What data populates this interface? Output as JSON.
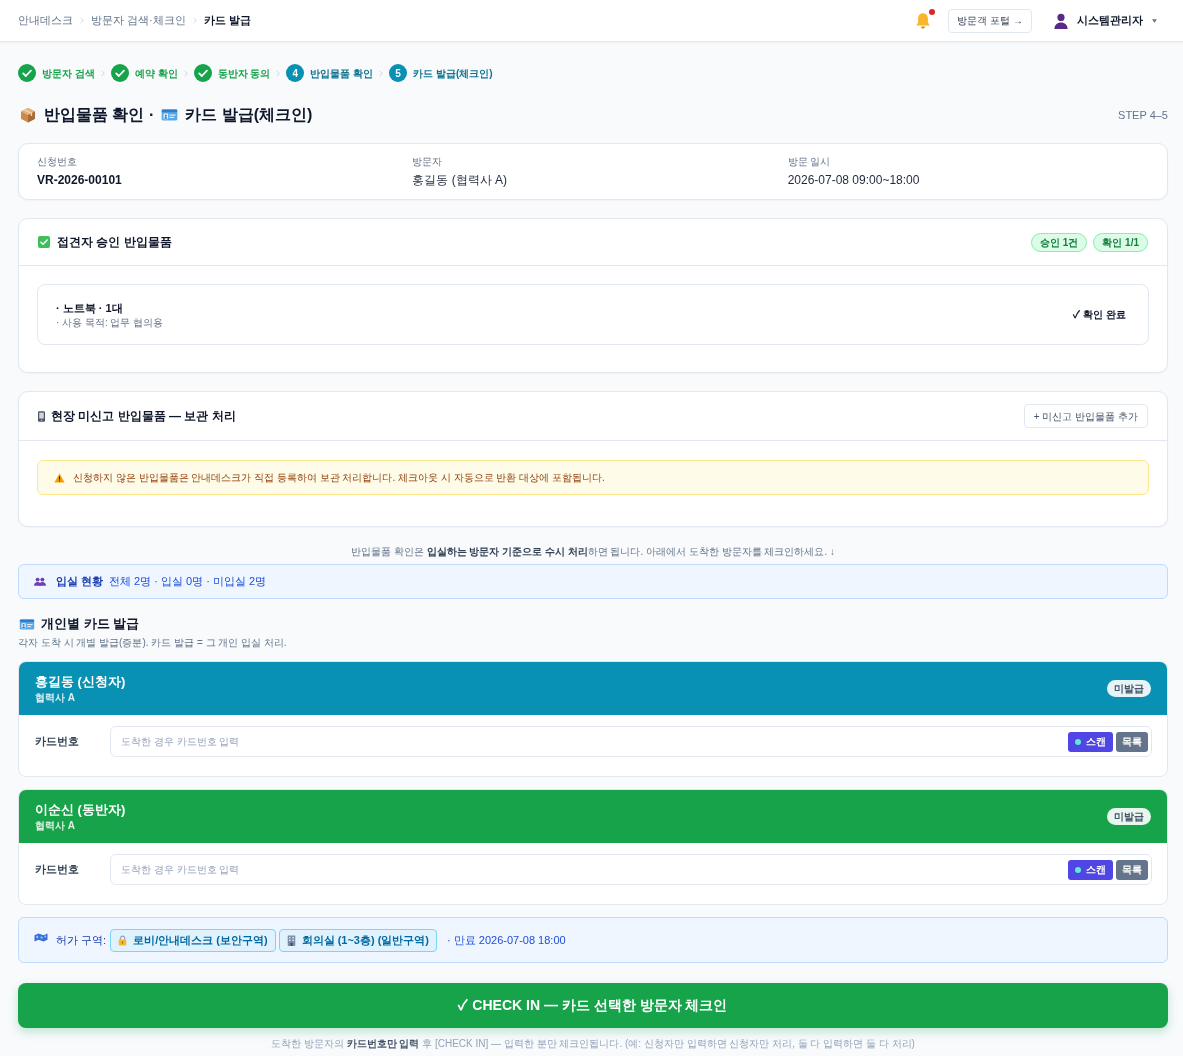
{
  "breadcrumb": [
    {
      "label": "안내데스크",
      "current": false
    },
    {
      "label": "방문자 검색·체크인",
      "current": false
    },
    {
      "label": "카드 발급",
      "current": true
    }
  ],
  "header": {
    "notifications_unread": true,
    "portal_button": "방문객 포털 →",
    "user": "시스템관리자"
  },
  "steps": [
    {
      "label": "방문자 검색",
      "done": true
    },
    {
      "label": "예약 확인",
      "done": true
    },
    {
      "label": "동반자 동의",
      "done": true
    },
    {
      "label": "반입물품 확인",
      "done": false,
      "number": "4"
    },
    {
      "label": "카드 발급(체크인)",
      "done": false,
      "number": "5"
    }
  ],
  "page_title": {
    "parts": [
      "반입물품 확인 ·",
      "카드 발급(체크인)"
    ],
    "step_range": "STEP 4–5"
  },
  "request_info": [
    {
      "label": "신청번호",
      "value": "VR-2026-00101",
      "emphasis": true
    },
    {
      "label": "방문자",
      "value": "홍길동 (협력사 A)",
      "emphasis": false
    },
    {
      "label": "방문 일시",
      "value": "2026-07-08 09:00~18:00",
      "emphasis": false
    }
  ],
  "approved_items": {
    "title": "접견자 승인 반입물품",
    "badges": [
      "승인 1건",
      "확인 1/1"
    ],
    "items": [
      {
        "name": "· 노트북 · 1대",
        "purpose": "· 사용 목적: 업무 협의용",
        "status": "✓ 확인 완료"
      }
    ]
  },
  "unreported_items": {
    "title": "현장 미신고 반입물품 — 보관 처리",
    "add_button": "+ 미신고 반입물품 추가",
    "warning": "신청하지 않은 반입물품은 안내데스크가 직접 등록하여 보관 처리합니다. 체크아웃 시 자동으로 반환 대상에 포함됩니다."
  },
  "note": "반입물품 확인은 **입실하는 방문자 기준으로 수시 처리**하면 됩니다. 아래에서 도착한 방문자를 체크인하세요. ↓",
  "entry_status": {
    "label": "입실 현황",
    "summary": "전체 2명 · 입실 0명 · 미입실 2명"
  },
  "card_issue": {
    "title": "개인별 카드 발급",
    "subtitle": "각자 도착 시 개별 발급(증분). 카드 발급 = 그 개인 입실 처리."
  },
  "visitors": [
    {
      "name": "홍길동 (신청자)",
      "company": "협력사 A",
      "color": "#0891b2",
      "status": "미발급",
      "field_label": "카드번호",
      "placeholder": "도착한 경우 카드번호 입력",
      "scan_button": "스캔",
      "list_button": "목록"
    },
    {
      "name": "이순신 (동반자)",
      "company": "협력사 A",
      "color": "#16a34a",
      "status": "미발급",
      "field_label": "카드번호",
      "placeholder": "도착한 경우 카드번호 입력",
      "scan_button": "스캔",
      "list_button": "목록"
    }
  ],
  "zones": {
    "label": "허가 구역:",
    "items": [
      {
        "kind": "lock",
        "label": "로비/안내데스크 (보안구역)"
      },
      {
        "kind": "building",
        "label": "회의실 (1~3층) (일반구역)"
      }
    ],
    "expiry": "· 만료 2026-07-08 18:00"
  },
  "check_in_button": "✓ CHECK IN — 카드 선택한 방문자 체크인",
  "footer_note": "도착한 방문자의 **카드번호만 입력** 후 [CHECK IN] — 입력한 분만 체크인됩니다. (예: 신청자만 입력하면 신청자만 처리, 둘 다 입력하면 둘 다 처리)"
}
